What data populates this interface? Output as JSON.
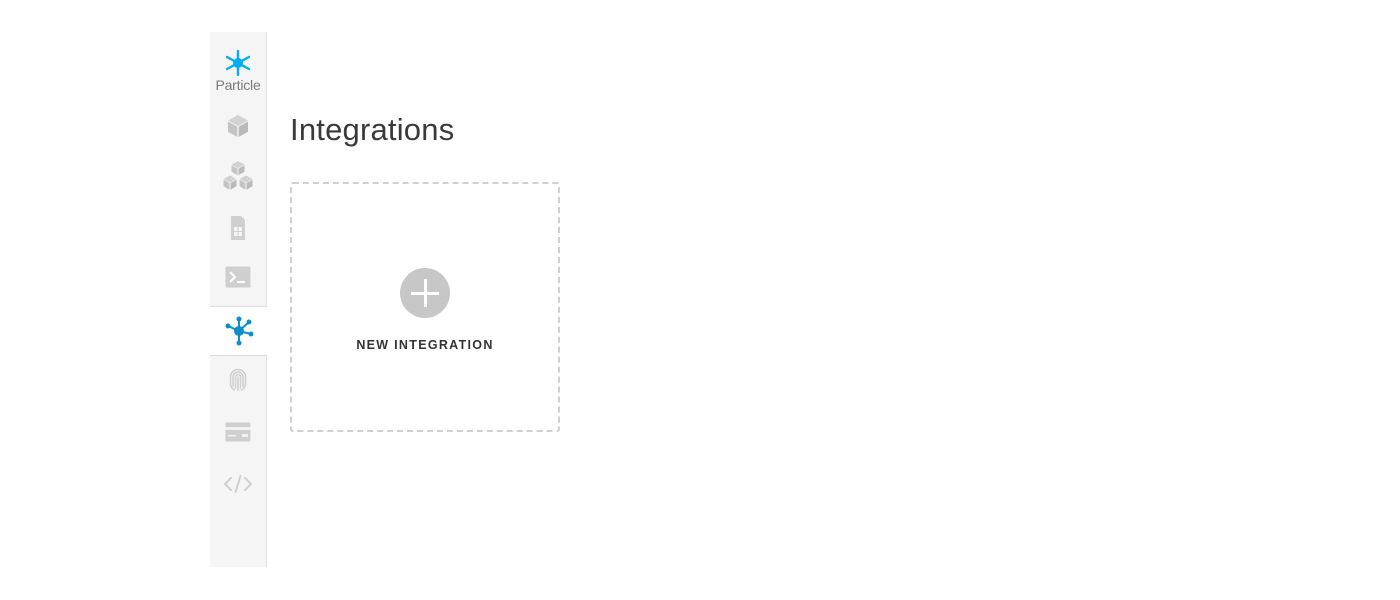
{
  "brand": {
    "name": "Particle",
    "accent": "#00aeef",
    "active_icon_color": "#0d8ec7"
  },
  "sidebar": {
    "items": [
      {
        "icon": "cube-icon",
        "label": "Devices",
        "active": false
      },
      {
        "icon": "cubes-icon",
        "label": "Products",
        "active": false
      },
      {
        "icon": "sim-card-icon",
        "label": "SIM Cards",
        "active": false
      },
      {
        "icon": "terminal-icon",
        "label": "Console",
        "active": false
      },
      {
        "icon": "integrations-icon",
        "label": "Integrations",
        "active": true
      },
      {
        "icon": "fingerprint-icon",
        "label": "Authentication",
        "active": false
      },
      {
        "icon": "credit-card-icon",
        "label": "Billing",
        "active": false
      },
      {
        "icon": "code-icon",
        "label": "Web IDE",
        "active": false
      }
    ],
    "inactive_icon_color": "#cfcfcf"
  },
  "main": {
    "title": "Integrations",
    "new_card": {
      "label": "NEW INTEGRATION"
    }
  }
}
